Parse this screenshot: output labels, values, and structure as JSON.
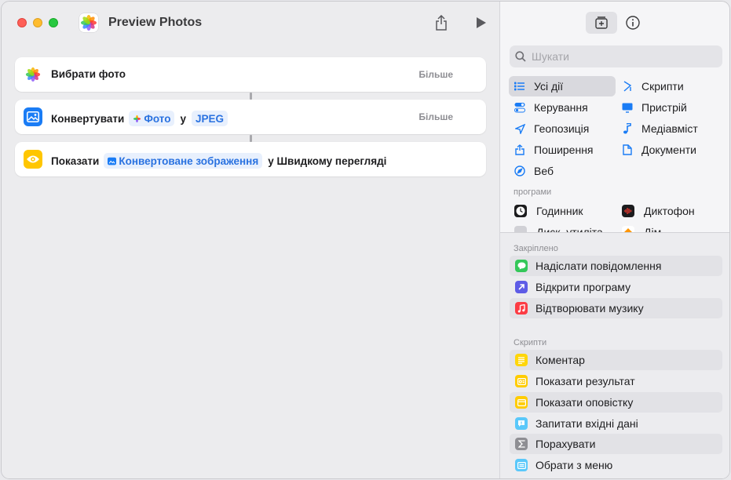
{
  "window": {
    "title": "Preview Photos"
  },
  "actions": [
    {
      "label": "Вибрати фото",
      "more": "Більше"
    },
    {
      "label": "Конвертувати",
      "token1": "Фото",
      "connector": "у",
      "token2": "JPEG",
      "more": "Більше"
    },
    {
      "label": "Показати",
      "token1": "Конвертоване зображення",
      "suffix": "у Швидкому перегляді"
    }
  ],
  "search": {
    "placeholder": "Шукати",
    "value": ""
  },
  "categories": [
    {
      "label": "Усі дії",
      "icon": "list-icon",
      "selected": true
    },
    {
      "label": "Скрипти",
      "icon": "scripting-icon"
    },
    {
      "label": "Керування",
      "icon": "toggle-icon"
    },
    {
      "label": "Пристрій",
      "icon": "display-icon"
    },
    {
      "label": "Геопозиція",
      "icon": "location-icon"
    },
    {
      "label": "Медіавміст",
      "icon": "music-note-icon"
    },
    {
      "label": "Поширення",
      "icon": "share-icon"
    },
    {
      "label": "Документи",
      "icon": "document-icon"
    },
    {
      "label": "Веб",
      "icon": "compass-icon"
    }
  ],
  "apps_section": {
    "label": "програми",
    "items": [
      {
        "label": "Годинник",
        "icon": "clock-app-icon"
      },
      {
        "label": "Диктофон",
        "icon": "voice-memos-app-icon"
      },
      {
        "label": "Диск. утиліта",
        "icon": "disk-utility-app-icon"
      },
      {
        "label": "Дім",
        "icon": "home-app-icon"
      }
    ]
  },
  "pinned": {
    "label": "Закріплено",
    "items": [
      {
        "label": "Надіслати повідомлення",
        "icon": "messages-icon",
        "color": "#34c759"
      },
      {
        "label": "Відкрити програму",
        "icon": "open-app-icon",
        "color": "#5e5ce6"
      },
      {
        "label": "Відтворювати музику",
        "icon": "music-icon",
        "color": "#fc3c44"
      }
    ]
  },
  "scripts": {
    "label": "Скрипти",
    "items": [
      {
        "label": "Коментар",
        "icon": "comment-icon",
        "color": "#ffd60a"
      },
      {
        "label": "Показати результат",
        "icon": "show-result-icon",
        "color": "#ffcc00"
      },
      {
        "label": "Показати оповістку",
        "icon": "alert-icon",
        "color": "#ffcc00"
      },
      {
        "label": "Запитати вхідні дані",
        "icon": "ask-input-icon",
        "color": "#5ac8fa"
      },
      {
        "label": "Порахувати",
        "icon": "sigma-icon",
        "color": "#8e8e93"
      },
      {
        "label": "Обрати з меню",
        "icon": "menu-icon",
        "color": "#5ac8fa"
      }
    ]
  }
}
